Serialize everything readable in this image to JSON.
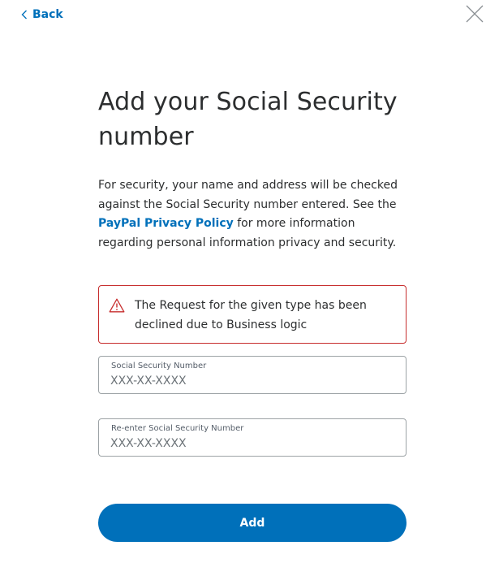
{
  "header": {
    "back_label": "Back",
    "back_icon": "chevron-left-icon",
    "close_icon": "close-icon"
  },
  "main": {
    "title": "Add your Social Security number",
    "description_before_link": "For security, your name and address will be checked against the Social Security number entered. See the ",
    "privacy_link": "PayPal Privacy Policy",
    "description_after_link": " for more information regarding personal information privacy and security."
  },
  "alert": {
    "icon": "warning-icon",
    "message": "The Request for the given type has been declined due to Business logic",
    "border_color": "#c72e2e"
  },
  "form": {
    "ssn": {
      "label": "Social Security Number",
      "value": "",
      "placeholder": "XXX-XX-XXXX"
    },
    "ssn_confirm": {
      "label": "Re-enter Social Security Number",
      "value": "",
      "placeholder": "XXX-XX-XXXX"
    },
    "submit_label": "Add"
  },
  "colors": {
    "accent": "#0070ba",
    "error": "#c72e2e",
    "text": "#2c2e2f"
  }
}
